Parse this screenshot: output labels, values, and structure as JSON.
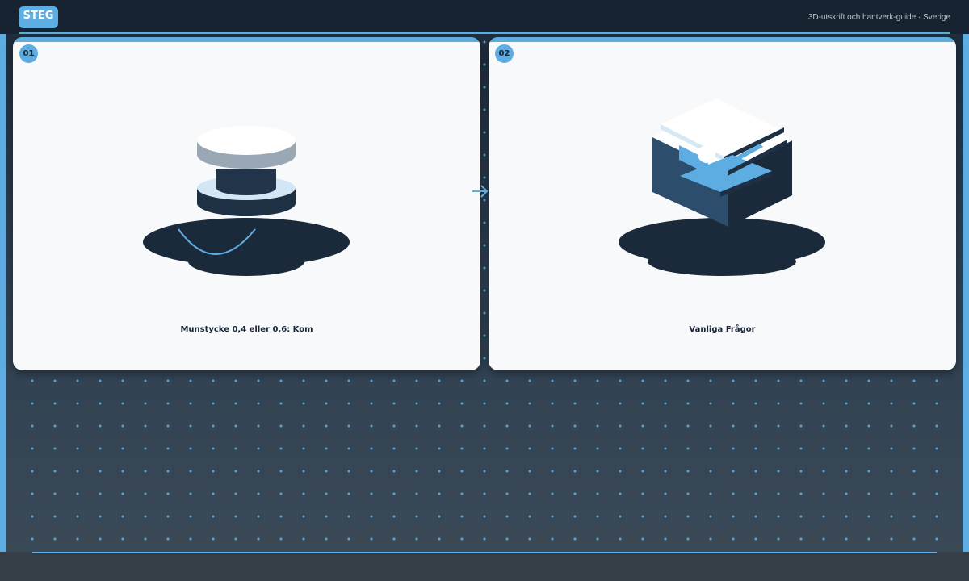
{
  "header": {
    "badge": "STEG",
    "title": "3D-utskrift och hantverk-guide · Sverige"
  },
  "steps": [
    {
      "number": "01",
      "label": "Munstycke 0,4 eller 0,6: Kom",
      "icon": "nozzle-icon"
    },
    {
      "number": "02",
      "label": "Vanliga Frågor",
      "icon": "cube-icon"
    }
  ],
  "colors": {
    "accent": "#5dade2",
    "dark": "#1a2a3b",
    "card": "#f7f9fb"
  }
}
